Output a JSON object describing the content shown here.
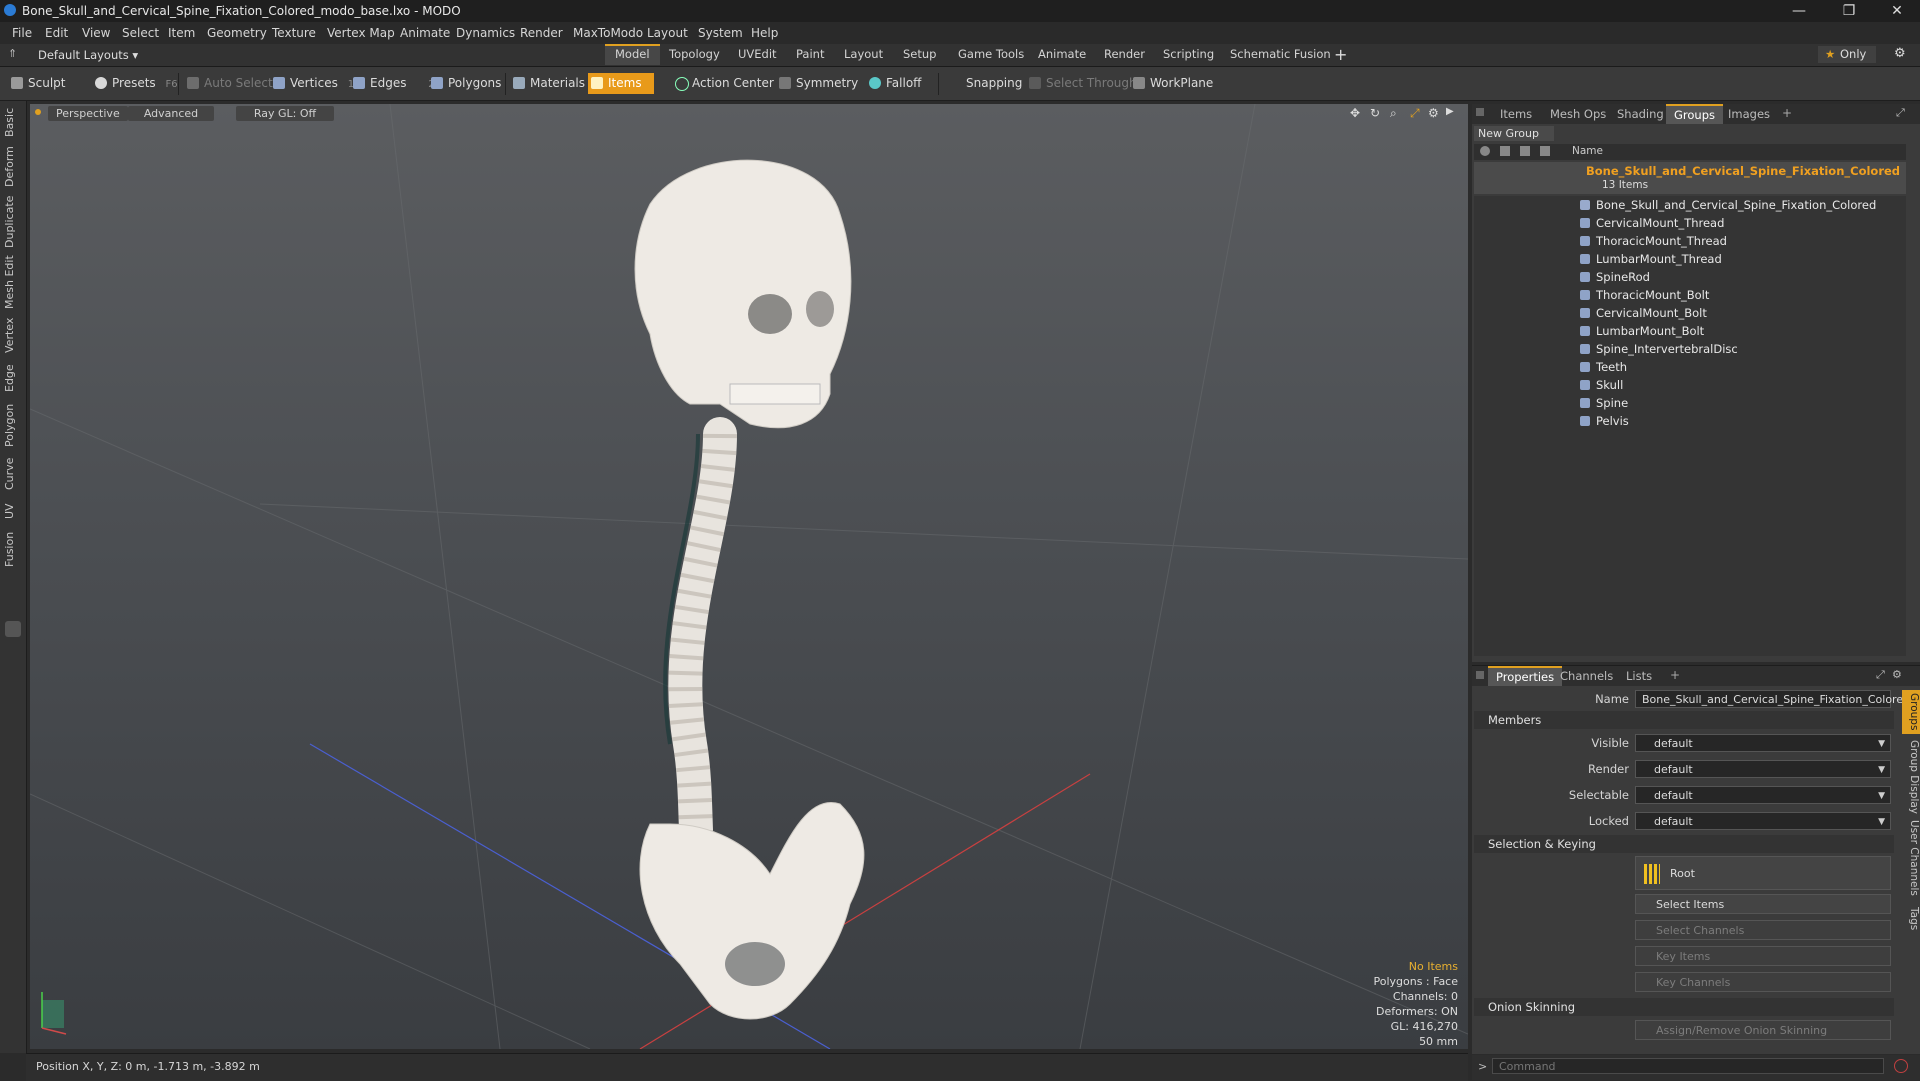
{
  "window": {
    "title": "Bone_Skull_and_Cervical_Spine_Fixation_Colored_modo_base.lxo - MODO",
    "minimize": "—",
    "restore": "❐",
    "close": "✕"
  },
  "menu": [
    "File",
    "Edit",
    "View",
    "Select",
    "Item",
    "Geometry",
    "Texture",
    "Vertex Map",
    "Animate",
    "Dynamics",
    "Render",
    "MaxToModo",
    "Layout",
    "System",
    "Help"
  ],
  "layouts_dropdown": "Default Layouts",
  "layout_tabs": [
    "Model",
    "Topology",
    "UVEdit",
    "Paint",
    "Layout",
    "Setup",
    "Game Tools",
    "Animate",
    "Render",
    "Scripting",
    "Schematic Fusion"
  ],
  "layout_add": "+",
  "only_label": "Only",
  "toolbar": {
    "sculpt": "Sculpt",
    "presets": "Presets",
    "presets_key": "F6",
    "auto_select": "Auto Select",
    "vertices": "Vertices",
    "vertices_key": "1",
    "edges": "Edges",
    "edges_key": "2",
    "polygons": "Polygons",
    "materials": "Materials",
    "items": "Items",
    "action_center": "Action Center",
    "symmetry": "Symmetry",
    "falloff": "Falloff",
    "snapping": "Snapping",
    "select_through": "Select Through",
    "workplane": "WorkPlane"
  },
  "left_tabs": [
    "Basic",
    "Deform",
    "Duplicate",
    "Mesh Edit",
    "Vertex",
    "Edge",
    "Polygon",
    "Curve",
    "UV",
    "Fusion"
  ],
  "viewport": {
    "perspective": "Perspective",
    "advanced": "Advanced",
    "raygl": "Ray GL: Off",
    "info": {
      "no_items": "No Items",
      "polygons": "Polygons : Face",
      "channels": "Channels: 0",
      "deformers": "Deformers: ON",
      "gl": "GL: 416,270",
      "lens": "50 mm"
    }
  },
  "status": {
    "position": "Position X, Y, Z:  0 m, -1.713 m, -3.892 m"
  },
  "top_panel": {
    "tabs": [
      "Items",
      "Mesh Ops",
      "Shading",
      "Groups",
      "Images"
    ],
    "active_tab": "Groups",
    "add": "+",
    "new_group": "New Group",
    "name_header": "Name",
    "group_name": "Bone_Skull_and_Cervical_Spine_Fixation_Colored",
    "item_count": "13 Items",
    "members": [
      "Bone_Skull_and_Cervical_Spine_Fixation_Colored",
      "CervicalMount_Thread",
      "ThoracicMount_Thread",
      "LumbarMount_Thread",
      "SpineRod",
      "ThoracicMount_Bolt",
      "CervicalMount_Bolt",
      "LumbarMount_Bolt",
      "Spine_IntervertebralDisc",
      "Teeth",
      "Skull",
      "Spine",
      "Pelvis"
    ]
  },
  "bottom_panel": {
    "tabs": [
      "Properties",
      "Channels",
      "Lists"
    ],
    "add": "+",
    "name_label": "Name",
    "name_value": "Bone_Skull_and_Cervical_Spine_Fixation_Colored (",
    "members_section": "Members",
    "visible_label": "Visible",
    "render_label": "Render",
    "selectable_label": "Selectable",
    "locked_label": "Locked",
    "default_value": "default",
    "selection_section": "Selection & Keying",
    "root": "Root",
    "select_items": "Select Items",
    "select_channels": "Select Channels",
    "key_items": "Key Items",
    "key_channels": "Key Channels",
    "onion_section": "Onion Skinning",
    "assign_onion": "Assign/Remove Onion Skinning",
    "command_placeholder": "Command",
    "side_tabs": [
      "Groups",
      "Group Display",
      "User Channels",
      "Tags"
    ]
  }
}
